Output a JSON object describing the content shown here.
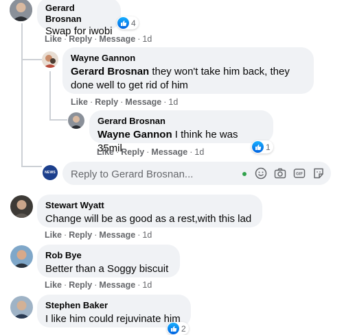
{
  "comments": [
    {
      "author": "Gerard Brosnan",
      "text": "Swap for iwobi",
      "reactions": "4",
      "actions": {
        "like": "Like",
        "reply": "Reply",
        "message": "Message",
        "time": "1d"
      }
    },
    {
      "author": "Wayne Gannon",
      "mention": "Gerard Brosnan",
      "text": " they won't take him back, they done well to get rid of him",
      "actions": {
        "like": "Like",
        "reply": "Reply",
        "message": "Message",
        "time": "1d"
      }
    },
    {
      "author": "Gerard Brosnan",
      "mention": "Wayne Gannon",
      "text": " I think he was 35mil",
      "reactions": "1",
      "actions": {
        "like": "Like",
        "reply": "Reply",
        "message": "Message",
        "time": "1d"
      }
    },
    {
      "author": "Stewart Wyatt",
      "text": "Change will be as good as a rest,with this lad",
      "actions": {
        "like": "Like",
        "reply": "Reply",
        "message": "Message",
        "time": "1d"
      }
    },
    {
      "author": "Rob Bye",
      "text": "Better than a Soggy biscuit",
      "actions": {
        "like": "Like",
        "reply": "Reply",
        "message": "Message",
        "time": "1d"
      }
    },
    {
      "author": "Stephen Baker",
      "text": "I like him could rejuvinate him",
      "reactions": "2"
    }
  ],
  "reply_box": {
    "placeholder": "Reply to Gerard Brosnan...",
    "avatar_text": "NEWS",
    "icons": [
      "emoji-icon",
      "camera-icon",
      "gif-icon",
      "sticker-icon"
    ]
  },
  "colors": {
    "bubble": "#f0f2f5",
    "like_blue": "#1877f2",
    "muted": "#65676b",
    "thread_line": "#ccd0d5",
    "online_green": "#31a24c"
  }
}
